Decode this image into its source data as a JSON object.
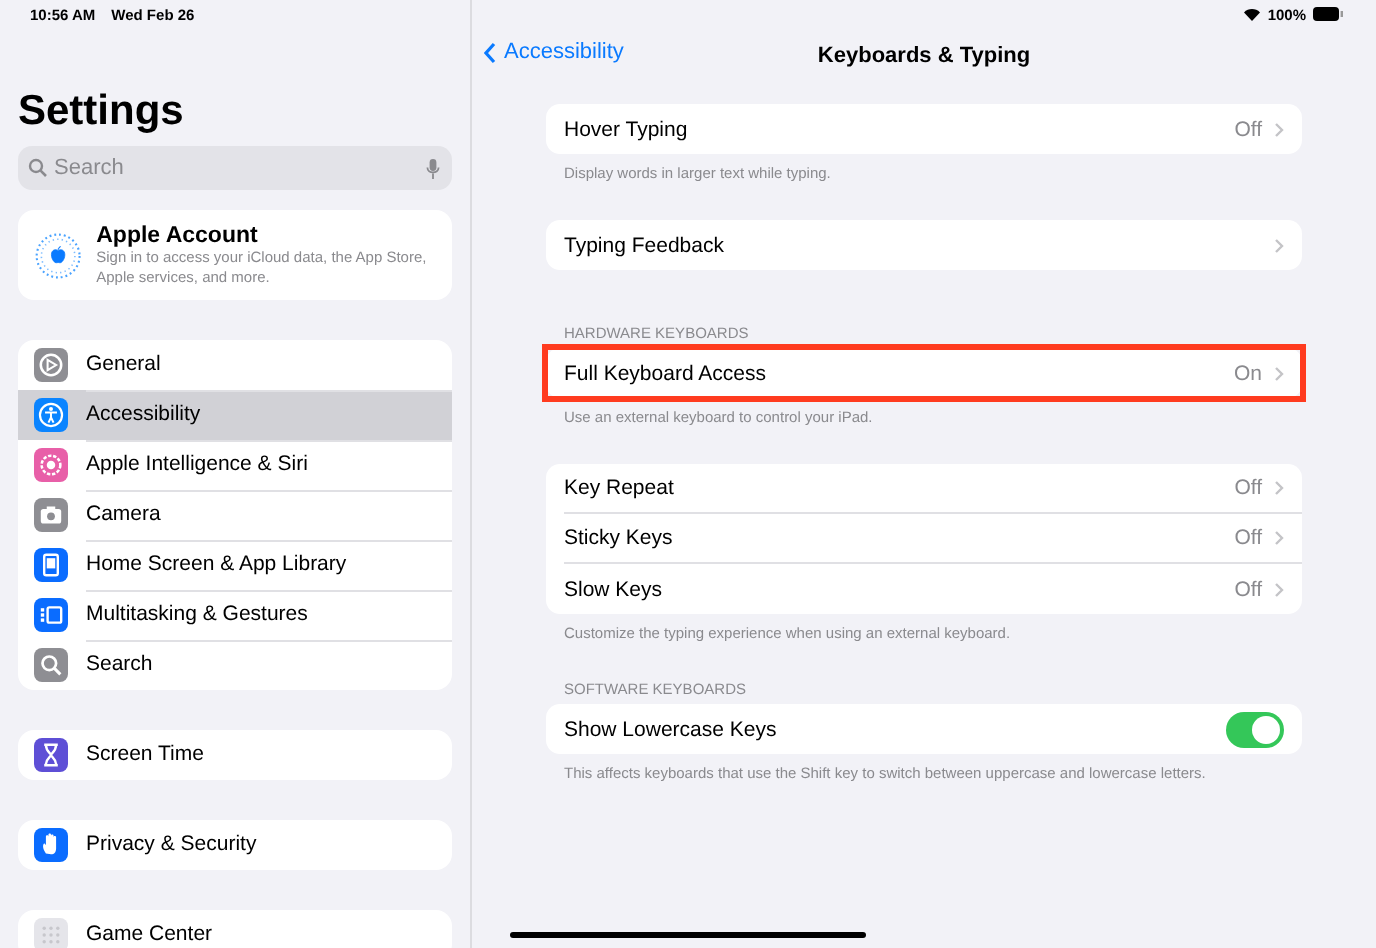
{
  "status_bar": {
    "time": "10:56 AM",
    "date": "Wed Feb 26",
    "battery": "100%"
  },
  "sidebar": {
    "title": "Settings",
    "search": {
      "placeholder": "Search"
    },
    "account": {
      "name": "Apple Account",
      "description": "Sign in to access your iCloud data, the App Store, Apple services, and more."
    },
    "groups": [
      {
        "items": [
          {
            "label": "General",
            "color": "#8e8e93",
            "selected": false
          },
          {
            "label": "Accessibility",
            "color": "#0a84ff",
            "selected": true
          },
          {
            "label": "Apple Intelligence & Siri",
            "color": "#e85fa8",
            "selected": false
          },
          {
            "label": "Camera",
            "color": "#8e8e93",
            "selected": false
          },
          {
            "label": "Home Screen & App Library",
            "color": "#0a6cff",
            "selected": false
          },
          {
            "label": "Multitasking & Gestures",
            "color": "#0a6cff",
            "selected": false
          },
          {
            "label": "Search",
            "color": "#8e8e93",
            "selected": false
          }
        ]
      },
      {
        "items": [
          {
            "label": "Screen Time",
            "color": "#5e4fd6",
            "selected": false
          }
        ]
      },
      {
        "items": [
          {
            "label": "Privacy & Security",
            "color": "#0a6cff",
            "selected": false
          }
        ]
      },
      {
        "items": [
          {
            "label": "Game Center",
            "color": "#e5e5ea",
            "selected": false
          }
        ]
      }
    ]
  },
  "detail": {
    "back": "Accessibility",
    "title": "Keyboards & Typing",
    "sections": [
      {
        "rows": [
          {
            "kind": "link",
            "label": "Hover Typing",
            "value": "Off",
            "highlighted": false
          }
        ],
        "footer": "Display words in larger text while typing."
      },
      {
        "rows": [
          {
            "kind": "link",
            "label": "Typing Feedback",
            "highlighted": false
          }
        ]
      },
      {
        "header": "HARDWARE KEYBOARDS",
        "rows": [
          {
            "kind": "link",
            "label": "Full Keyboard Access",
            "value": "On",
            "highlighted": true
          }
        ],
        "footer": "Use an external keyboard to control your iPad."
      },
      {
        "rows": [
          {
            "kind": "link",
            "label": "Key Repeat",
            "value": "Off",
            "highlighted": false
          },
          {
            "kind": "link",
            "label": "Sticky Keys",
            "value": "Off",
            "highlighted": false
          },
          {
            "kind": "link",
            "label": "Slow Keys",
            "value": "Off",
            "highlighted": false
          }
        ],
        "footer": "Customize the typing experience when using an external keyboard."
      },
      {
        "header": "SOFTWARE KEYBOARDS",
        "rows": [
          {
            "kind": "toggle",
            "label": "Show Lowercase Keys",
            "on": true,
            "highlighted": false
          }
        ],
        "footer": "This affects keyboards that use the Shift key to switch between uppercase and lowercase letters."
      }
    ]
  }
}
